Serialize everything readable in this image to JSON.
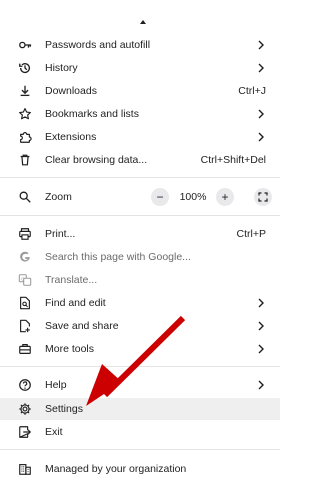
{
  "menu": {
    "passwords": {
      "label": "Passwords and autofill",
      "icon": "key-icon"
    },
    "history": {
      "label": "History",
      "icon": "history-icon"
    },
    "downloads": {
      "label": "Downloads",
      "shortcut": "Ctrl+J",
      "icon": "download-icon"
    },
    "bookmarks": {
      "label": "Bookmarks and lists",
      "icon": "star-icon"
    },
    "extensions": {
      "label": "Extensions",
      "icon": "puzzle-icon"
    },
    "clear": {
      "label": "Clear browsing data...",
      "shortcut": "Ctrl+Shift+Del",
      "icon": "trash-icon"
    },
    "zoom": {
      "label": "Zoom",
      "minus": "−",
      "value": "100%",
      "plus": "+",
      "icon": "zoom-icon"
    },
    "print": {
      "label": "Print...",
      "shortcut": "Ctrl+P",
      "icon": "printer-icon"
    },
    "search_google": {
      "label": "Search this page with Google...",
      "icon": "google-icon"
    },
    "translate": {
      "label": "Translate...",
      "icon": "translate-icon"
    },
    "find_edit": {
      "label": "Find and edit",
      "icon": "find-icon"
    },
    "save_share": {
      "label": "Save and share",
      "icon": "share-icon"
    },
    "more_tools": {
      "label": "More tools",
      "icon": "toolbox-icon"
    },
    "help": {
      "label": "Help",
      "icon": "help-icon"
    },
    "settings": {
      "label": "Settings",
      "icon": "gear-icon"
    },
    "exit": {
      "label": "Exit",
      "icon": "exit-icon"
    },
    "managed": {
      "label": "Managed by your organization",
      "icon": "building-icon"
    }
  },
  "annotation": {
    "color": "#cc0000"
  }
}
